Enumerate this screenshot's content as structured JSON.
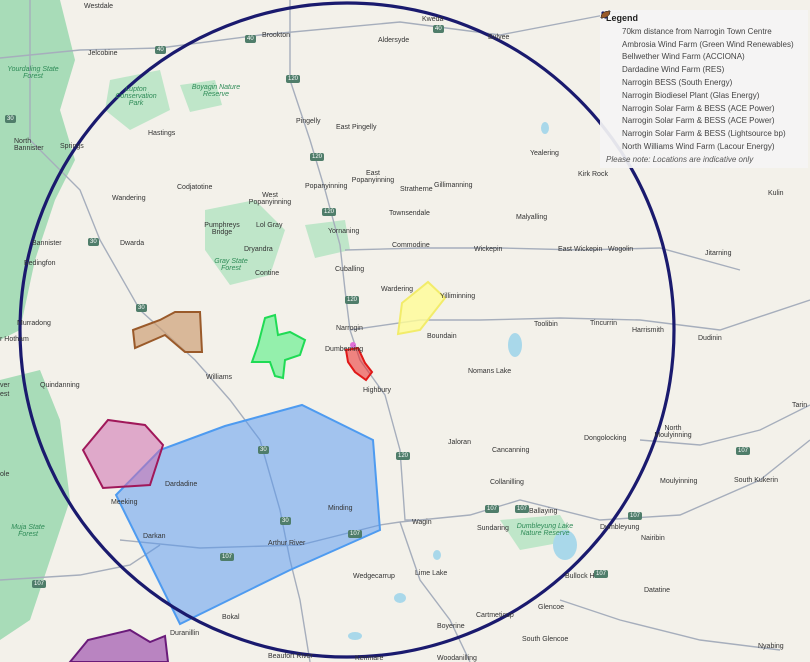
{
  "legend": {
    "title": "Legend",
    "items": [
      {
        "label": "70km distance from Narrogin Town Centre",
        "color": "#1a1a6e",
        "icon": "dots-icon"
      },
      {
        "label": "Ambrosia Wind Farm (Green Wind Renewables)",
        "color": "#6a1b7a",
        "icon": "leaf-icon"
      },
      {
        "label": "Bellwether Wind Farm (ACCIONA)",
        "color": "#5b8fd8",
        "icon": "leaf-icon"
      },
      {
        "label": "Dardadine Wind Farm (RES)",
        "color": "#a0185a",
        "icon": "leaf-icon"
      },
      {
        "label": "Narrogin BESS (South Energy)",
        "color": "#2e7d5b",
        "icon": "leaf-icon"
      },
      {
        "label": "Narrogin Biodiesel Plant (Glas Energy)",
        "color": "#e070d8",
        "icon": "leaf-icon"
      },
      {
        "label": "Narrogin Solar Farm & BESS (ACE Power)",
        "color": "#7a0c0c",
        "icon": "leaf-icon"
      },
      {
        "label": "Narrogin Solar Farm & BESS (ACE Power)",
        "color": "#d81b1b",
        "icon": "leaf-icon"
      },
      {
        "label": "Narrogin Solar Farm & BESS (Lightsource bp)",
        "color": "#f3ee7a",
        "icon": "leaf-icon"
      },
      {
        "label": "North Williams Wind Farm (Lacour Energy)",
        "color": "#9a5a2a",
        "icon": "leaf-icon"
      }
    ],
    "note": "Please note: Locations are indicative only"
  },
  "places": [
    {
      "text": "Westdale"
    },
    {
      "text": "Brookton"
    },
    {
      "text": "Kweda"
    },
    {
      "text": "Bulyee"
    },
    {
      "text": "Jelcobine"
    },
    {
      "text": "Aldersyde"
    },
    {
      "text": "Yourdaling State Forest"
    },
    {
      "text": "Lupton Conservation Park"
    },
    {
      "text": "Boyagin Nature Reserve"
    },
    {
      "text": "North Bannister"
    },
    {
      "text": "Springs"
    },
    {
      "text": "Hastings"
    },
    {
      "text": "Pingelly"
    },
    {
      "text": "East Pingelly"
    },
    {
      "text": "Yealering"
    },
    {
      "text": "Kirk Rock"
    },
    {
      "text": "Codjatotine"
    },
    {
      "text": "Popanyinning"
    },
    {
      "text": "East Popanyinning"
    },
    {
      "text": "Stratherne"
    },
    {
      "text": "Gillimanning"
    },
    {
      "text": "Kulin"
    },
    {
      "text": "Wandering"
    },
    {
      "text": "West Popanyinning"
    },
    {
      "text": "Pumphreys Bridge"
    },
    {
      "text": "Lol Gray"
    },
    {
      "text": "Townsendale"
    },
    {
      "text": "Malyalling"
    },
    {
      "text": "Bannister"
    },
    {
      "text": "Dwarda"
    },
    {
      "text": "Yornaning"
    },
    {
      "text": "Commodine"
    },
    {
      "text": "Wickepin"
    },
    {
      "text": "East Wickepin"
    },
    {
      "text": "Wogolin"
    },
    {
      "text": "Jitarning"
    },
    {
      "text": "Bedingfon"
    },
    {
      "text": "Dryandra"
    },
    {
      "text": "Gray State Forest"
    },
    {
      "text": "Contine"
    },
    {
      "text": "Cuballing"
    },
    {
      "text": "Wardering"
    },
    {
      "text": "Yilliminning"
    },
    {
      "text": "Narrogin"
    },
    {
      "text": "Boundain"
    },
    {
      "text": "Toolibin"
    },
    {
      "text": "Tincurrin"
    },
    {
      "text": "Harrismith"
    },
    {
      "text": "Dudinin"
    },
    {
      "text": "Murradong"
    },
    {
      "text": "r Hotham"
    },
    {
      "text": "Dumberning"
    },
    {
      "text": "Nomans Lake"
    },
    {
      "text": "Quindanning"
    },
    {
      "text": "Williams"
    },
    {
      "text": "Highbury"
    },
    {
      "text": "Tarin"
    },
    {
      "text": "North Moulyinning"
    },
    {
      "text": "Jaloran"
    },
    {
      "text": "Dongolocking"
    },
    {
      "text": "Cancanning"
    },
    {
      "text": "Dardadine"
    },
    {
      "text": "Collanilling"
    },
    {
      "text": "Moulyinning"
    },
    {
      "text": "South Kukerin"
    },
    {
      "text": "Meeking"
    },
    {
      "text": "Minding"
    },
    {
      "text": "Ballaying"
    },
    {
      "text": "Wagin"
    },
    {
      "text": "Sundaring"
    },
    {
      "text": "Dumbleyung Lake Nature Reserve"
    },
    {
      "text": "Dumbleyung"
    },
    {
      "text": "Muja State Forest"
    },
    {
      "text": "Darkan"
    },
    {
      "text": "Arthur River"
    },
    {
      "text": "Nairibin"
    },
    {
      "text": "Wedgecarrup"
    },
    {
      "text": "Lime Lake"
    },
    {
      "text": "Bullock Hills"
    },
    {
      "text": "Datatine"
    },
    {
      "text": "Glencoe"
    },
    {
      "text": "Cartmeticup"
    },
    {
      "text": "Bokal"
    },
    {
      "text": "Duranillin"
    },
    {
      "text": "Boyerine"
    },
    {
      "text": "South Glencoe"
    },
    {
      "text": "Nyabing"
    },
    {
      "text": "Beaufort River"
    },
    {
      "text": "Kenmare"
    },
    {
      "text": "Woodanilling"
    },
    {
      "text": "ver"
    },
    {
      "text": "est"
    },
    {
      "text": "ole"
    }
  ],
  "route_shields": [
    "40",
    "40",
    "40",
    "120",
    "120",
    "30",
    "120",
    "30",
    "120",
    "120",
    "30",
    "107",
    "107",
    "107",
    "107",
    "107",
    "30",
    "107",
    "107",
    "107",
    "30"
  ]
}
